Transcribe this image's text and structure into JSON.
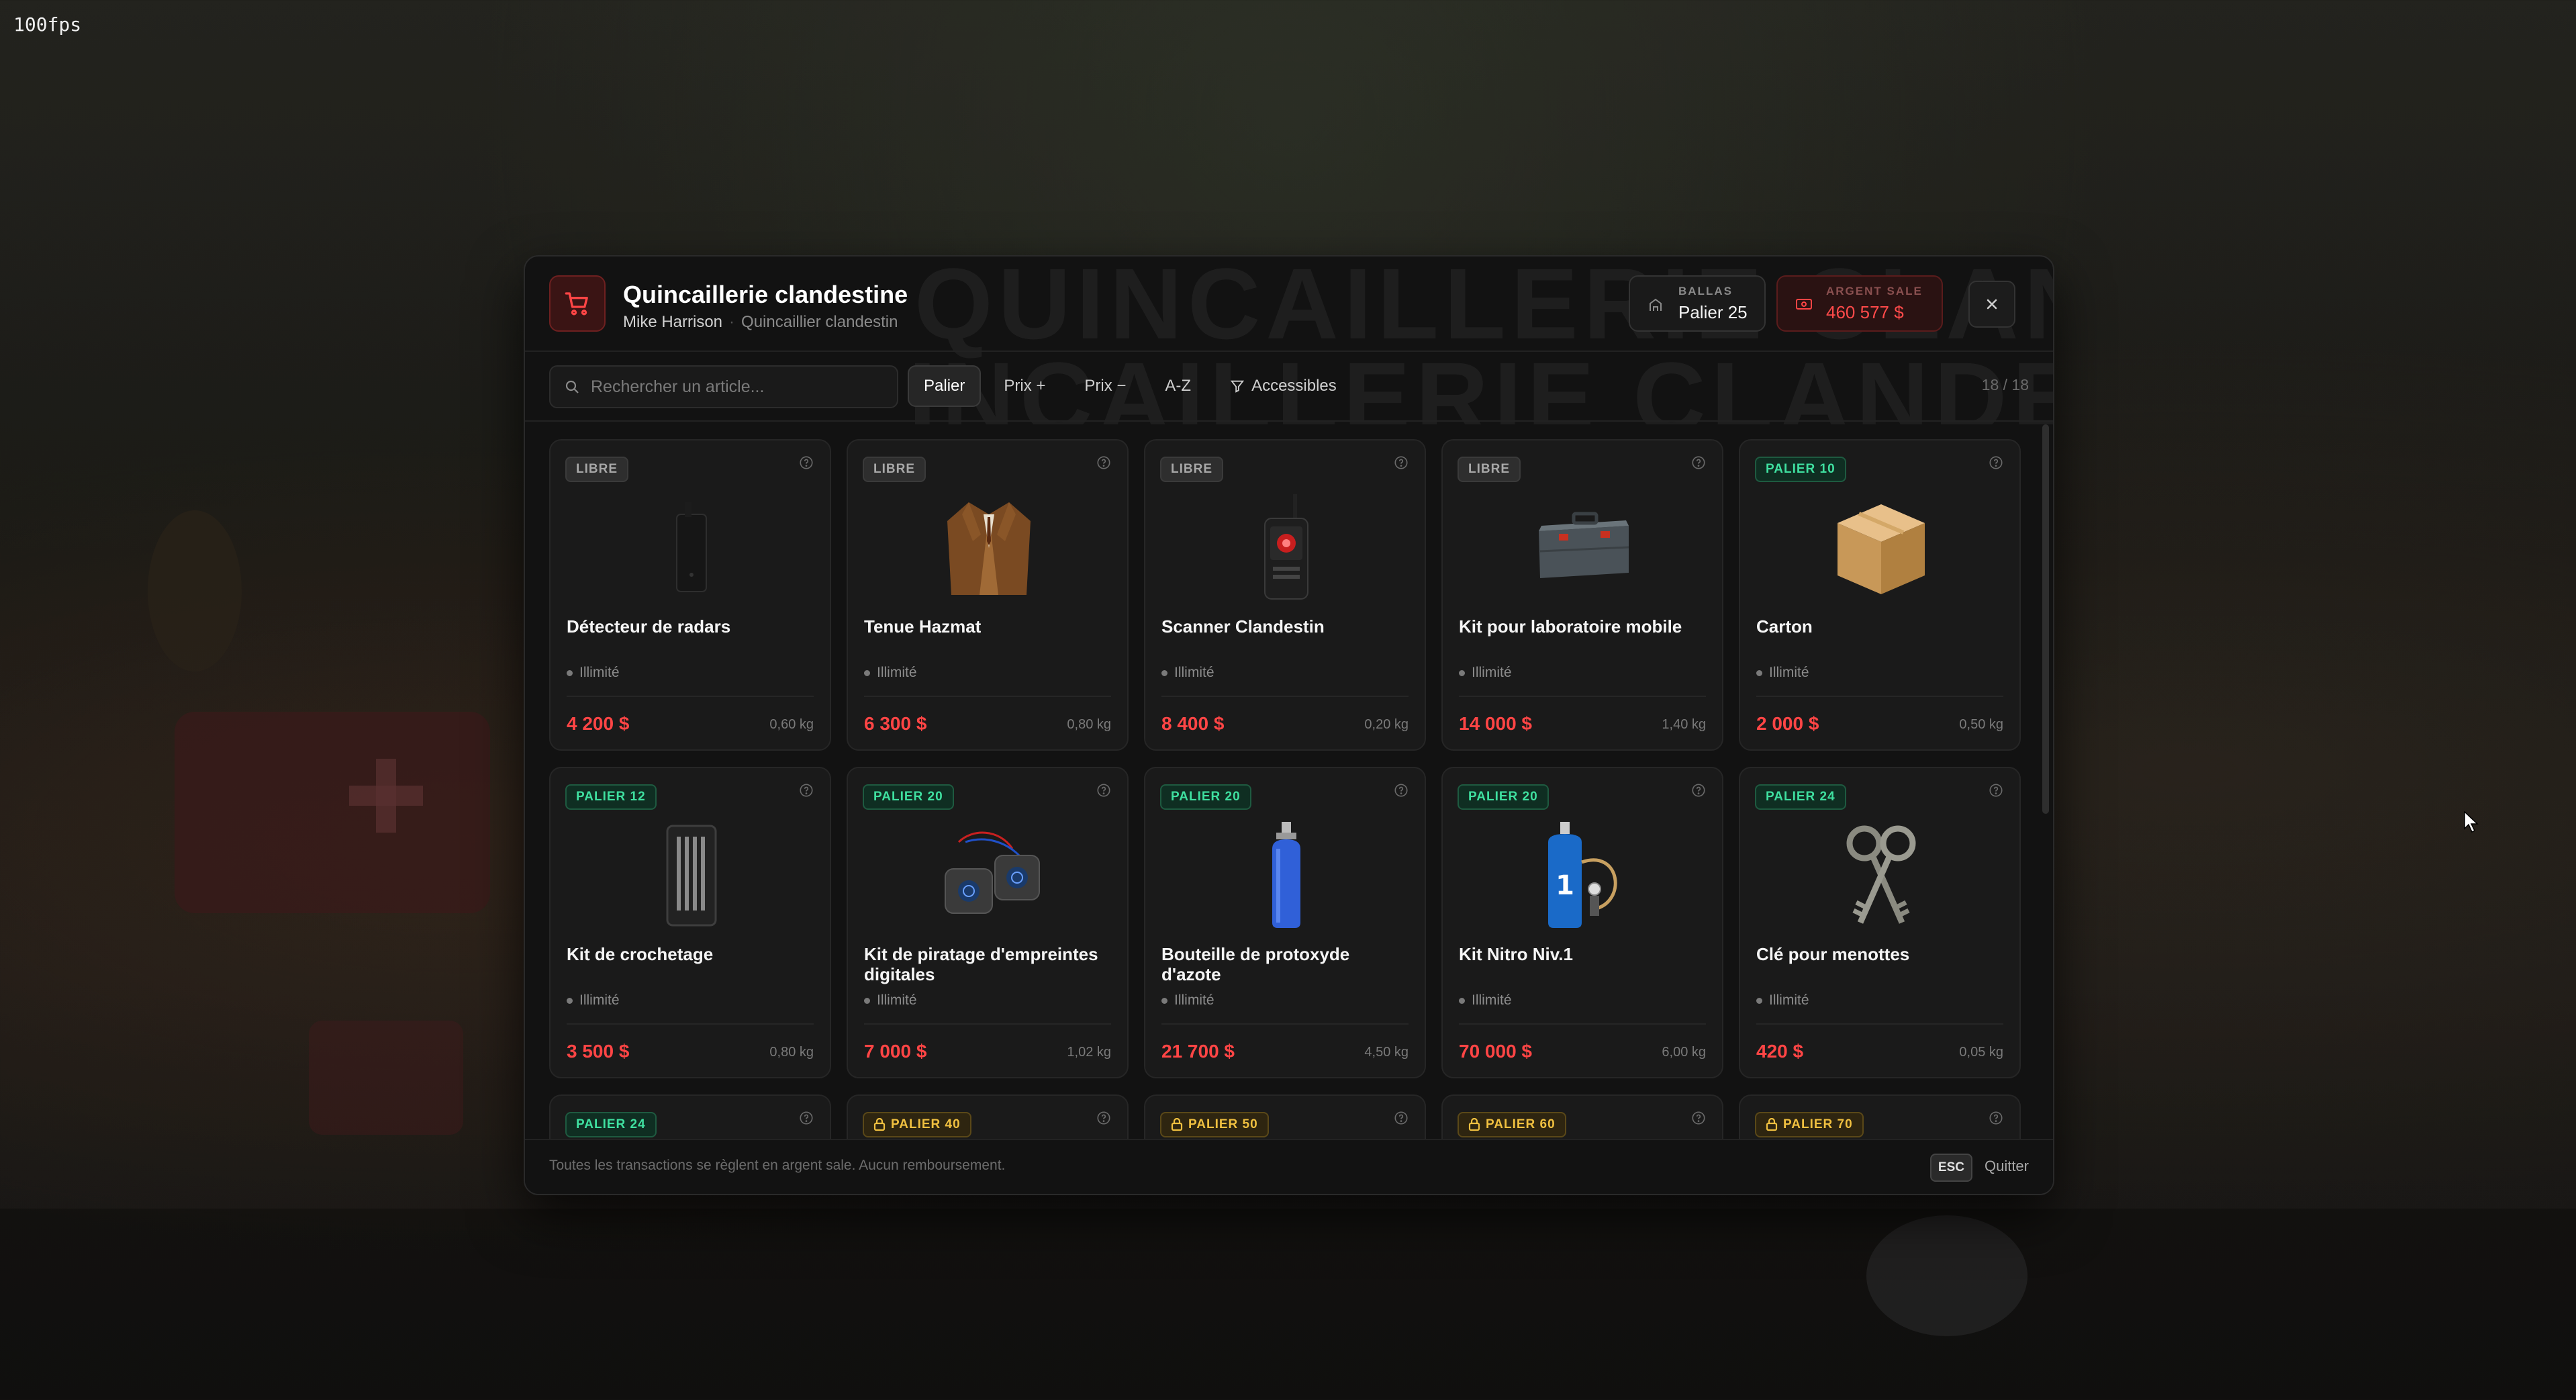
{
  "hud": {
    "fps": "100fps"
  },
  "shop": {
    "watermark_lines": [
      "QUINCAILLERIE CLANDESTINE",
      "QUINCAILLERIE CLANDESTINE"
    ],
    "title": "Quincaillerie clandestine",
    "vendor": "Mike Harrison",
    "vendor_role": "Quincaillier clandestin"
  },
  "stats": {
    "gang_label": "BALLAS",
    "gang_value": "Palier 25",
    "money_label": "ARGENT SALE",
    "money_value": "460 577 $"
  },
  "toolbar": {
    "search_placeholder": "Rechercher un article...",
    "sort_options": [
      "Palier",
      "Prix +",
      "Prix −",
      "A-Z"
    ],
    "filter_label": "Accessibles",
    "count": "18 / 18"
  },
  "items": [
    {
      "badge": "LIBRE",
      "badge_type": "libre",
      "name": "Détecteur de radars",
      "stock": "Illimité",
      "price": "4 200 $",
      "weight": "0,60 kg",
      "icon": "radar-detector-icon"
    },
    {
      "badge": "LIBRE",
      "badge_type": "libre",
      "name": "Tenue Hazmat",
      "stock": "Illimité",
      "price": "6 300 $",
      "weight": "0,80 kg",
      "icon": "jacket-icon"
    },
    {
      "badge": "LIBRE",
      "badge_type": "libre",
      "name": "Scanner Clandestin",
      "stock": "Illimité",
      "price": "8 400 $",
      "weight": "0,20 kg",
      "icon": "scanner-icon"
    },
    {
      "badge": "LIBRE",
      "badge_type": "libre",
      "name": "Kit pour laboratoire mobile",
      "stock": "Illimité",
      "price": "14 000 $",
      "weight": "1,40 kg",
      "icon": "toolbox-icon"
    },
    {
      "badge": "PALIER 10",
      "badge_type": "tier",
      "name": "Carton",
      "stock": "Illimité",
      "price": "2 000 $",
      "weight": "0,50 kg",
      "icon": "cardboard-box-icon"
    },
    {
      "badge": "PALIER 12",
      "badge_type": "tier",
      "name": "Kit de crochetage",
      "stock": "Illimité",
      "price": "3 500 $",
      "weight": "0,80 kg",
      "icon": "lockpick-kit-icon"
    },
    {
      "badge": "PALIER 20",
      "badge_type": "tier",
      "name": "Kit de piratage d'empreintes digitales",
      "stock": "Illimité",
      "price": "7 000 $",
      "weight": "1,02 kg",
      "icon": "fingerprint-hacker-icon"
    },
    {
      "badge": "PALIER 20",
      "badge_type": "tier",
      "name": "Bouteille de protoxyde d'azote",
      "stock": "Illimité",
      "price": "21 700 $",
      "weight": "4,50 kg",
      "icon": "gas-bottle-icon"
    },
    {
      "badge": "PALIER 20",
      "badge_type": "tier",
      "name": "Kit Nitro Niv.1",
      "stock": "Illimité",
      "price": "70 000 $",
      "weight": "6,00 kg",
      "icon": "nitro-kit-icon"
    },
    {
      "badge": "PALIER 24",
      "badge_type": "tier",
      "name": "Clé pour menottes",
      "stock": "Illimité",
      "price": "420 $",
      "weight": "0,05 kg",
      "icon": "handcuff-keys-icon"
    },
    {
      "badge": "PALIER 24",
      "badge_type": "tier",
      "name": "",
      "stock": "",
      "price": "",
      "weight": "",
      "icon": ""
    },
    {
      "badge": "PALIER 40",
      "badge_type": "locked",
      "name": "",
      "stock": "",
      "price": "",
      "weight": "",
      "icon": ""
    },
    {
      "badge": "PALIER 50",
      "badge_type": "locked",
      "name": "",
      "stock": "",
      "price": "",
      "weight": "",
      "icon": ""
    },
    {
      "badge": "PALIER 60",
      "badge_type": "locked",
      "name": "",
      "stock": "",
      "price": "",
      "weight": "",
      "icon": ""
    },
    {
      "badge": "PALIER 70",
      "badge_type": "locked",
      "name": "",
      "stock": "",
      "price": "",
      "weight": "",
      "icon": ""
    }
  ],
  "footer": {
    "note": "Toutes les transactions se règlent en argent sale. Aucun remboursement.",
    "esc_key": "ESC",
    "esc_label": "Quitter"
  },
  "colors": {
    "accent_red": "#ff4545",
    "tier_green": "#3fe0a0",
    "locked_gold": "#f0c040"
  }
}
